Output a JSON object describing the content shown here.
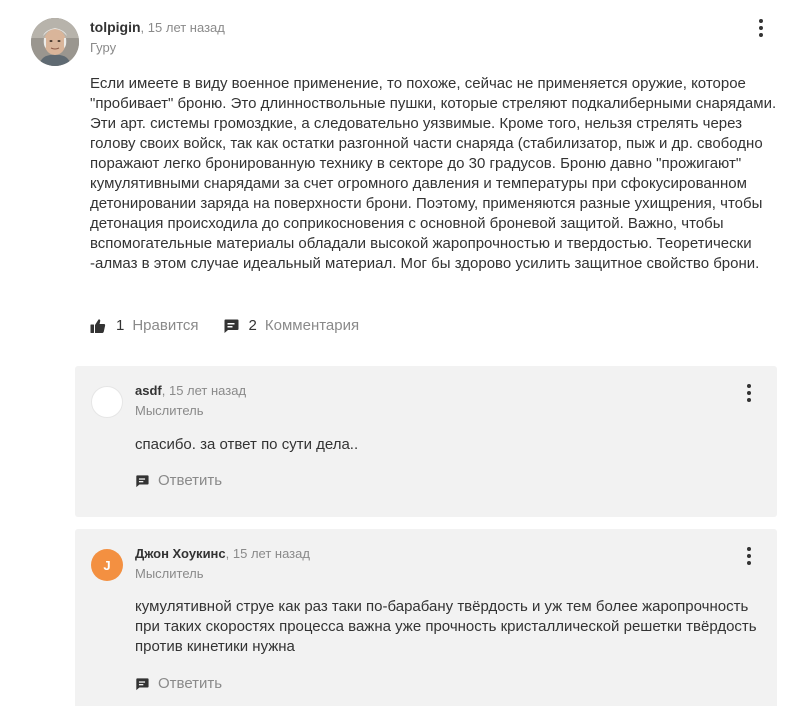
{
  "answer": {
    "author": "tolpigin",
    "time": "15 лет назад",
    "rank": "Гуру",
    "paragraphs": [
      "Если имеете в виду военное применение, то похоже, сейчас не применяется оружие, которое \"пробивает\" броню. Это длинноствольные пушки, которые стреляют подкалиберными снарядами. Эти арт. системы громоздкие, а следовательно уязвимые. Кроме того, нельзя стрелять через голову своих войск, так как остатки разгонной части снаряда (стабилизатор, пыж и др. свободно поражают легко бронированную технику в секторе до 30 градусов. Броню давно \"прожигают\" кумулятивными снарядами за счет огромного давления и температуры при сфокусированном детонировании заряда на поверхности брони. Поэтому, применяются разные ухищрения, чтобы детонация происходила до соприкосновения с основной броневой защитой. Важно, чтобы вспомогательные материалы обладали высокой жаропрочностью и твердостью. Теоретически -алмаз в этом случае идеальный материал. Мог бы здорово усилить защитное свойство брони."
    ],
    "likes_count": "1",
    "likes_label": "Нравится",
    "comments_count": "2",
    "comments_label": "Комментария"
  },
  "comments": [
    {
      "author": "asdf",
      "time": "15 лет назад",
      "rank": "Мыслитель",
      "avatar_initial": "",
      "avatar_color": "#ffffff",
      "text": "спасибо. за ответ по сути дела..",
      "reply_label": "Ответить"
    },
    {
      "author": "Джон Хоукинс",
      "time": "15 лет назад",
      "rank": "Мыслитель",
      "avatar_initial": "J",
      "avatar_color": "#f39041",
      "text": "кумулятивной струе как раз таки по-барабану твёрдость и уж тем более жаропрочность при таких скоростях процесса важна уже прочность кристаллической решетки твёрдость против кинетики нужна",
      "reply_label": "Ответить"
    }
  ],
  "separator": ", ",
  "icons": {
    "like": "thumbs-up-icon",
    "comments": "comment-bubble-icon",
    "reply": "reply-bubble-icon",
    "more": "more-vertical-icon"
  }
}
